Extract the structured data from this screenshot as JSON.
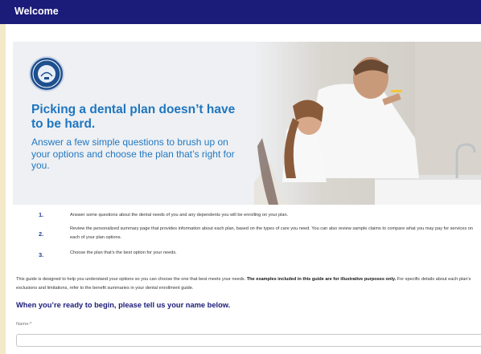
{
  "header": {
    "title": "Welcome"
  },
  "hero": {
    "headline": "Picking a dental plan doesn’t have to be hard.",
    "subhead": "Answer a few simple questions to brush up on your options and choose the plan that’s right for you."
  },
  "steps": [
    {
      "num": "1.",
      "text": "Answer some questions about the dental needs of you and any dependents you will be enrolling on your plan."
    },
    {
      "num": "2.",
      "text": "Review the personalized summary page that provides information about each plan, based on the types of care you need. You can also review sample claims to compare what you may pay for services on each of your plan options."
    },
    {
      "num": "3.",
      "text": "Choose the plan that’s the best option for your needs."
    }
  ],
  "intro": {
    "text1": "This guide is designed to help you understand your options so you can choose the one that best meets your needs. ",
    "bold": "The examples included in this guide are for illustrative purposes only.",
    "text2": " For specific details about each plan’s exclusions and limitations, refer to the benefit summaries in your dental enrollment guide."
  },
  "cta": "When you’re ready to begin, please tell us your name below.",
  "form": {
    "name_label": "Name:*",
    "name_value": ""
  },
  "colors": {
    "header_bg": "#1b1b7a",
    "accent_blue": "#1f76bf",
    "page_bg": "#f3e9c8"
  }
}
